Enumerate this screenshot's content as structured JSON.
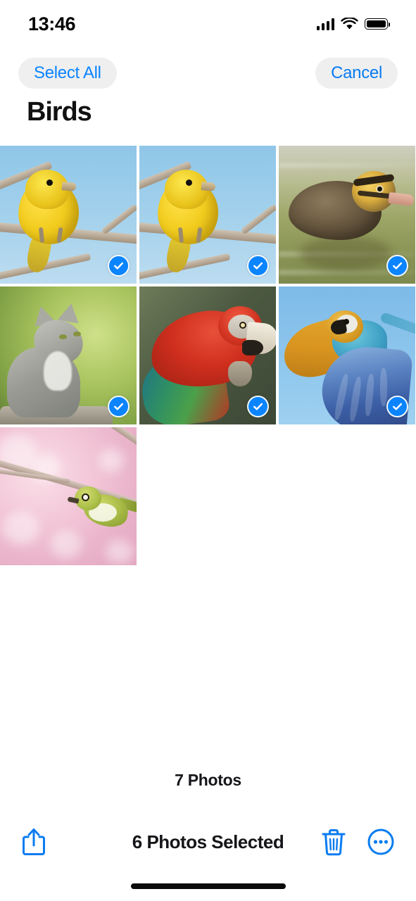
{
  "status_bar": {
    "time": "13:46",
    "signal_icon": "cellular-signal-icon",
    "wifi_icon": "wifi-icon",
    "battery_icon": "battery-full-icon"
  },
  "nav": {
    "select_all_label": "Select All",
    "cancel_label": "Cancel"
  },
  "header": {
    "title": "Birds"
  },
  "grid": {
    "photos": [
      {
        "name": "yellow-canary-on-branch",
        "alt": "Yellow canary perched on branch against blue sky",
        "selected": true
      },
      {
        "name": "yellow-canary-on-branch-duplicate",
        "alt": "Yellow canary perched on branch against blue sky",
        "selected": true
      },
      {
        "name": "duckling-in-water",
        "alt": "Brown duckling swimming in green water",
        "selected": true
      },
      {
        "name": "grey-kitten-looking-up",
        "alt": "Grey tabby kitten looking upward on green background",
        "selected": true
      },
      {
        "name": "scarlet-macaw",
        "alt": "Red scarlet macaw parrot with green and blue wing feathers",
        "selected": true
      },
      {
        "name": "blue-gold-macaw-flying",
        "alt": "Blue and gold macaw flying against blue sky",
        "selected": true
      },
      {
        "name": "white-eye-bird-cherry-blossom",
        "alt": "Green white-eye bird on branch with pink cherry blossoms",
        "selected": false
      }
    ],
    "checkmark_icon": "checkmark-circle-icon"
  },
  "footer": {
    "photo_count": "7 Photos",
    "selection_status": "6 Photos Selected",
    "share_icon": "share-icon",
    "trash_icon": "trash-icon",
    "more_icon": "ellipsis-circle-icon"
  },
  "colors": {
    "accent_blue": "#0a84ff",
    "pill_background": "#efeff0",
    "text_primary": "#16161a"
  }
}
